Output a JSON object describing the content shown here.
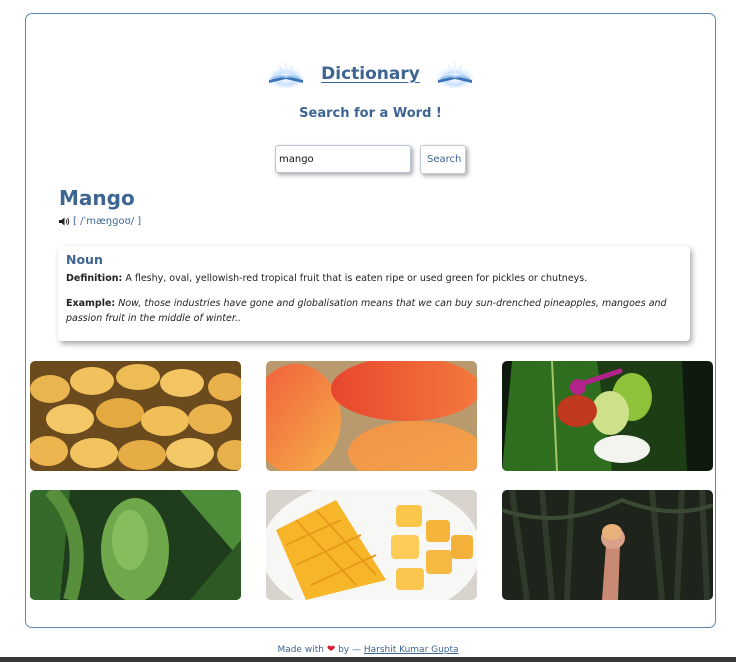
{
  "header": {
    "title": "Dictionary",
    "subtitle": "Search for a Word !"
  },
  "search": {
    "value": "mango",
    "button_label": "Search"
  },
  "entry": {
    "word": "Mango",
    "phonetic": "[ /ˈmæŋɡoʊ/ ]",
    "part_of_speech": "Noun",
    "definition_label": "Definition:",
    "definition": "A fleshy, oval, yellowish-red tropical fruit that is eaten ripe or used green for pickles or chutneys.",
    "example_label": "Example:",
    "example": "Now, those industries have gone and globalisation means that we can buy sun-drenched pineapples, mangoes and passion fruit in the middle of winter.."
  },
  "gallery": {
    "count": 6,
    "images": [
      "mango-pile-photo",
      "red-mangoes-photo",
      "mango-chili-powder-photo",
      "mango-on-tree-photo",
      "diced-mango-photo",
      "hand-holding-mango-photo"
    ]
  },
  "footer": {
    "made_with": "Made with",
    "by": "by —",
    "author": "Harshit Kumar Gupta"
  },
  "colors": {
    "accent": "#3d6591",
    "border": "#5f86b3",
    "heart": "#d61f2c"
  },
  "icons": {
    "logo": "book-glow-icon",
    "audio": "speaker-icon",
    "heart": "heart-icon"
  }
}
